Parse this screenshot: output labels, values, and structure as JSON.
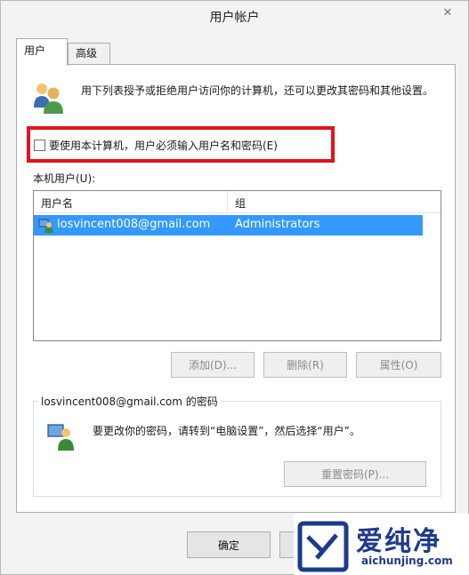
{
  "window": {
    "title": "用户帐户",
    "close": "✕"
  },
  "tabs": [
    {
      "label": "用户"
    },
    {
      "label": "高级"
    }
  ],
  "intro": "用下列表授予或拒绝用户访问你的计算机，还可以更改其密码和其他设置。",
  "require_login": {
    "label": "要使用本计算机，用户必须输入用户名和密码(E)",
    "checked": false
  },
  "local_users": {
    "label": "本机用户(U):",
    "columns": [
      "用户名",
      "组"
    ],
    "rows": [
      {
        "name": "losvincent008@gmail.com",
        "group": "Administrators"
      }
    ]
  },
  "buttons": {
    "add": "添加(D)...",
    "remove": "删除(R)",
    "properties": "属性(O)"
  },
  "password": {
    "legend": "losvincent008@gmail.com 的密码",
    "text": "要更改你的密码，请转到“电脑设置”，然后选择“用户”。",
    "reset": "重置密码(P)..."
  },
  "footer": {
    "ok": "确定",
    "cancel": ""
  },
  "watermark": {
    "cn": "爱纯净",
    "url": "aichunjing.com"
  },
  "colors": {
    "selection": "#3399ff",
    "highlight_box": "#e0141c",
    "watermark": "#1e3a8a"
  }
}
